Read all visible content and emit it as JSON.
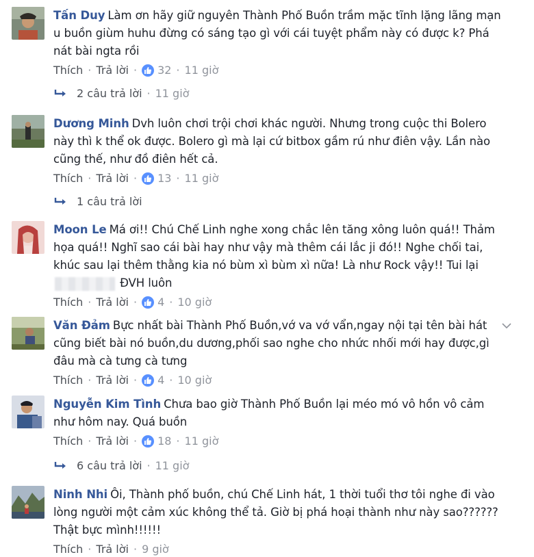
{
  "actions": {
    "like": "Thích",
    "reply": "Trả lời"
  },
  "colors": {
    "author": "#365899",
    "meta": "#90949c",
    "like_badge": "#5890ff"
  },
  "comments": [
    {
      "author": "Tấn Duy",
      "text": "Làm ơn hãy giữ nguyên Thành Phố Buồn trầm mặc tĩnh lặng lãng mạn u buồn giùm huhu đừng có sáng tạo gì với cái tuyệt phẩm này có được k? Phá nát bài ngta rồi",
      "likes": "32",
      "time": "11 giờ",
      "replies": "2 câu trả lời",
      "replies_time": "11 giờ"
    },
    {
      "author": "Dương Minh",
      "text": "Dvh luôn chơi trội chơi khác người. Nhưng trong cuộc thi Bolero này thì k thể ok được. Bolero gì mà lại cứ bitbox gầm rú như điên vậy. Lần nào cũng thế, như đồ điên hết cả.",
      "likes": "13",
      "time": "11 giờ",
      "replies": "1 câu trả lời"
    },
    {
      "author": "Moon Le",
      "text": "Má ơi!! Chú Chế Linh nghe xong chắc lên tăng xông luôn quá!! Thảm họa quá!! Nghĩ sao cái bài hay như vậy mà thêm cái lắc ji đó!! Nghe chối tai, khúc sau lại thêm thằng kia nó bùm xì bùm xì nữa! Là như Rock vậy!! Tui lại",
      "text_after_blur": "ĐVH luôn",
      "likes": "4",
      "time": "10 giờ"
    },
    {
      "author": "Văn Đảm",
      "text": "Bực nhất bài Thành Phố Buồn,vớ va vớ vẩn,ngay nội tại tên bài hát cũng biết bài nó buồn,du dương,phối sao nghe cho nhức nhối mới hay được,gì đâu mà cà tưng cà tưng",
      "likes": "4",
      "time": "10 giờ"
    },
    {
      "author": "Nguyễn Kim Tình",
      "text": "Chưa bao giờ Thành Phố Buồn lại méo mó vô hồn vô cảm như hôm nay. Quá buồn",
      "likes": "18",
      "time": "11 giờ",
      "replies": "6 câu trả lời",
      "replies_time": "11 giờ"
    },
    {
      "author": "Ninh Nhi",
      "text": "Ôi, Thành phố buồn, chú Chế Linh hát, 1 thời tuổi thơ tôi nghe đi vào lòng người một cảm xúc không thể tả. Giờ bị phá hoại thành như này sao?????? Thật bực mình!!!!!!",
      "time": "9 giờ"
    }
  ]
}
